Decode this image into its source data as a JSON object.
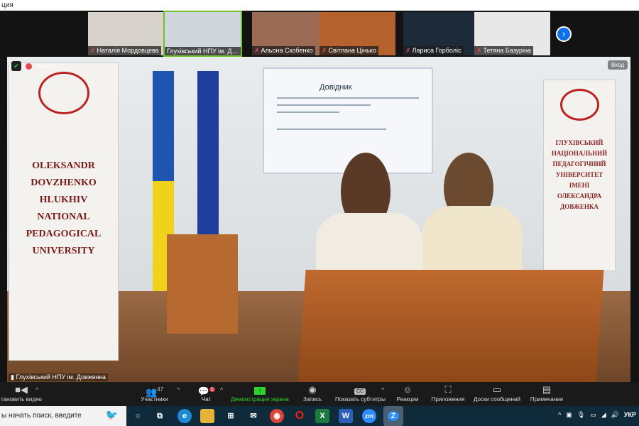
{
  "window": {
    "title_fragment": "ция"
  },
  "participants_strip": [
    {
      "name": "Наталія Мордовцева",
      "muted": true,
      "bg": "#d8d2cc"
    },
    {
      "name": "Глухівський НПУ ім. Дов...",
      "muted": false,
      "active": true,
      "bg": "#cfd6dc"
    },
    {
      "name": "Альона Скобенко",
      "muted": true,
      "bg": "#9a6a52"
    },
    {
      "name": "Світлана Цінько",
      "muted": true,
      "bg": "#b5622e"
    },
    {
      "name": "Лариса Горболіс",
      "muted": true,
      "bg": "#1d2a3a"
    },
    {
      "name": "Тетяна Базуріна",
      "muted": true,
      "bg": "#e8e8e8"
    }
  ],
  "video": {
    "recording_label": "Запись",
    "exit_label": "Вход",
    "speaker_name": "Глухівський НПУ ім. Довженка",
    "left_banner": "OLEKSANDR DOVZHENKO HLUKHIV NATIONAL PEDAGOGICAL UNIVERSITY",
    "right_banner": "ГЛУХІВСЬКИЙ НАЦІОНАЛЬНИЙ ПЕДАГОГІЧНИЙ УНІВЕРСИТЕТ ІМЕНІ ОЛЕКСАНДРА ДОВЖЕНКА",
    "slide_title": "Довідник"
  },
  "toolbar": {
    "video": "тановить видео",
    "participants": "Участники",
    "participants_count": "47",
    "chat": "Чат",
    "chat_badge": "1",
    "share": "Демонстрация экрана",
    "record": "Запись",
    "captions": "Показать субтитры",
    "captions_icon": "CC",
    "reactions": "Реакции",
    "apps": "Приложения",
    "whiteboards": "Доски сообщений",
    "notes": "Примечания"
  },
  "taskbar": {
    "search_placeholder": "ы начать поиск, введите",
    "apps": [
      "excel",
      "word",
      "zoom-meetings",
      "zoom"
    ],
    "excel": "X",
    "word": "W",
    "zm": "zm",
    "zoom": "Z",
    "language": "УКР"
  },
  "colors": {
    "accent": "#0e71eb",
    "share_green": "#2bd32b",
    "muted_red": "#e5484d"
  }
}
